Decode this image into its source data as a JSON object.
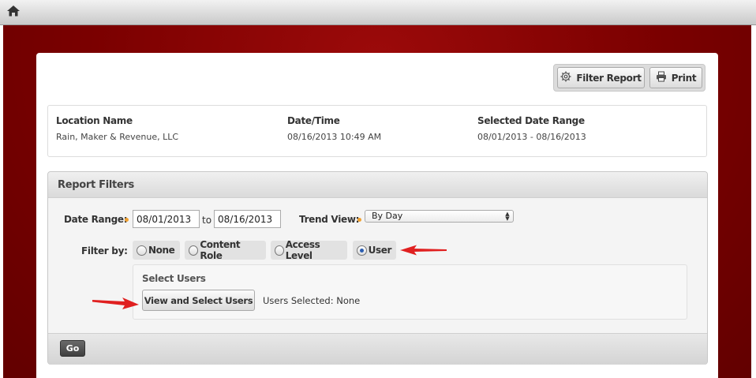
{
  "topbar": {
    "home_icon": "home-icon"
  },
  "toolbar": {
    "filter_report_label": "Filter Report",
    "filter_report_icon": "gear-icon",
    "print_label": "Print",
    "print_icon": "printer-icon"
  },
  "info": {
    "location_label": "Location Name",
    "location_value": "Rain, Maker & Revenue, LLC",
    "datetime_label": "Date/Time",
    "datetime_value": "08/16/2013 10:49 AM",
    "range_label": "Selected Date Range",
    "range_value": "08/01/2013 - 08/16/2013"
  },
  "filters": {
    "title": "Report Filters",
    "date_range_label": "Date Range:",
    "date_from": "08/01/2013",
    "to_label": "to",
    "date_to": "08/16/2013",
    "trend_view_label": "Trend View:",
    "trend_view_value": "By Day",
    "filter_by_label": "Filter by:",
    "options": [
      {
        "label": "None",
        "selected": false
      },
      {
        "label": "Content Role",
        "selected": false
      },
      {
        "label": "Access Level",
        "selected": false
      },
      {
        "label": "User",
        "selected": true
      }
    ],
    "select_users_title": "Select Users",
    "view_select_label": "View and Select Users",
    "users_selected": "Users Selected: None",
    "go_label": "Go"
  },
  "colors": {
    "brand_red": "#7a0000",
    "annotation_arrow": "#e02020",
    "required_dot": "#f0a030"
  }
}
